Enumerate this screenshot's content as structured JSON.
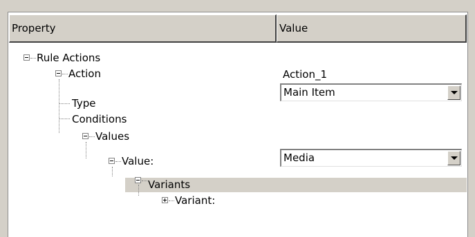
{
  "header": {
    "property_label": "Property",
    "value_label": "Value"
  },
  "tree": {
    "rule_actions": "Rule Actions",
    "action": "Action",
    "action_value": "Action_1",
    "type": "Type",
    "type_value": "Main Item",
    "conditions": "Conditions",
    "values": "Values",
    "value_label": "Value:",
    "value_value": "Media",
    "variants": "Variants",
    "variant": "Variant:"
  },
  "colors": {
    "selected_row": "#d4d0c8",
    "panel_bg": "#ffffff",
    "chrome": "#d4d0c8"
  }
}
